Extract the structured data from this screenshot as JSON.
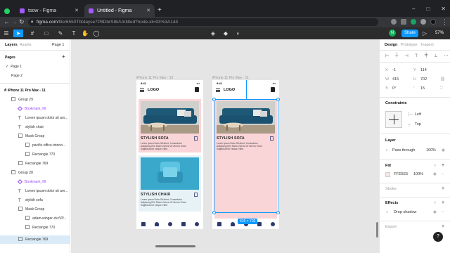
{
  "browser": {
    "tabs": [
      {
        "title": "tsow - Figma",
        "active": false
      },
      {
        "title": "Untitled - Figma",
        "active": true
      }
    ],
    "url_host": "figma.com",
    "url_path": "/file/6550Tbt4ayse7P8DbrS8k/Untitled?node-id=93%3A144"
  },
  "toolbar": {
    "user_initial": "N",
    "share_label": "Share",
    "zoom_label": "57%"
  },
  "left_panel": {
    "tabs": [
      "Layers",
      "Assets"
    ],
    "page_selector": "Page 1",
    "pages_title": "Pages",
    "pages": [
      "Page 1",
      "Page 2"
    ],
    "layers": [
      {
        "label": "iPhone 11 Pro Max - 11",
        "type": "frame"
      },
      {
        "label": "Group 29",
        "type": "group"
      },
      {
        "label": "Bookmark_fill",
        "type": "component"
      },
      {
        "label": "Lorem ipsum dolor sit am...",
        "type": "text"
      },
      {
        "label": "stylish chair",
        "type": "text"
      },
      {
        "label": "Mask Group",
        "type": "group"
      },
      {
        "label": "pacific-office-interio...",
        "type": "image"
      },
      {
        "label": "Rectangle 770",
        "type": "rect"
      },
      {
        "label": "Rectangle 769",
        "type": "rect"
      },
      {
        "label": "Group 28",
        "type": "group"
      },
      {
        "label": "Bookmark_fill",
        "type": "component"
      },
      {
        "label": "Lorem ipsum dolor sit am...",
        "type": "text"
      },
      {
        "label": "stylish sofa",
        "type": "text"
      },
      {
        "label": "Mask Group",
        "type": "group"
      },
      {
        "label": "adam-winger-ckcVP...",
        "type": "image"
      },
      {
        "label": "Rectangle 770",
        "type": "rect"
      },
      {
        "label": "Rectangle 769",
        "type": "rect"
      }
    ]
  },
  "canvas": {
    "frames": [
      {
        "label": "iPhone 11 Pro Max - 10"
      },
      {
        "label": "iPhone 11 Pro Max - 11"
      }
    ],
    "status_time": "9:41",
    "logo": "LOGO",
    "sofa_title": "STYLISH SOFA",
    "chair_title": "STYLISH CHAIR",
    "lorem": "Lorem Ipsum Dolor Sit Amet, Consectetur Adipiscing Elit. Etiam Viverra Ut Viverra Tortor Sagittis Amet. Neque, Nibh.",
    "selection_size": "415 × 702"
  },
  "right_panel": {
    "tabs": [
      "Design",
      "Prototype",
      "Inspect"
    ],
    "x": "-1",
    "y": "114",
    "w": "415",
    "h": "702",
    "rotation": "0°",
    "radius": "15",
    "constraints_title": "Constraints",
    "constraint_h": "Left",
    "constraint_v": "Top",
    "layer_title": "Layer",
    "blend": "Pass through",
    "layer_opacity": "100%",
    "fill_title": "Fill",
    "fill_hex": "FFE5E5",
    "fill_opacity": "100%",
    "stroke_title": "Stroke",
    "effects_title": "Effects",
    "effect": "Drop shadow",
    "export_title": "Export",
    "colors": {
      "accent": "#0d99ff",
      "fill": "#ffe5e5"
    }
  }
}
